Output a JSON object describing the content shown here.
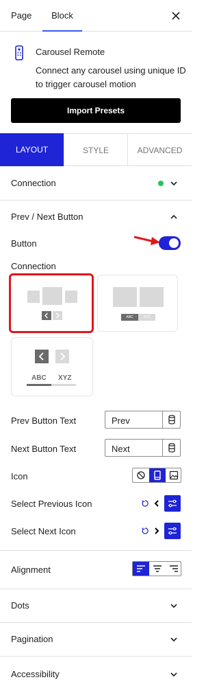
{
  "tabs": {
    "page": "Page",
    "block": "Block"
  },
  "block": {
    "title": "Carousel Remote",
    "description": "Connect any carousel using unique ID to trigger carousel motion",
    "icon": "remote-control-icon"
  },
  "import_button": "Import Presets",
  "section_tabs": {
    "layout": "LAYOUT",
    "style": "STYLE",
    "advanced": "ADVANCED"
  },
  "panels": {
    "connection": "Connection",
    "prev_next": "Prev / Next Button",
    "dots": "Dots",
    "pagination": "Pagination",
    "accessibility": "Accessibility"
  },
  "prev_next": {
    "button_label": "Button",
    "button_on": true,
    "connection_label": "Connection",
    "layout_options": [
      {
        "id": "arrows-under-slides",
        "selected": true
      },
      {
        "id": "abc-xyz-tabs",
        "tab_a": "ABC",
        "tab_b": "XYZ",
        "selected": false
      },
      {
        "id": "arrows-with-labels",
        "tab_a": "ABC",
        "tab_b": "XYZ",
        "selected": false
      }
    ],
    "prev_text_label": "Prev Button Text",
    "prev_text_value": "Prev",
    "next_text_label": "Next Button Text",
    "next_text_value": "Next",
    "icon_label": "Icon",
    "select_prev_label": "Select Previous Icon",
    "select_next_label": "Select Next Icon",
    "alignment_label": "Alignment"
  },
  "colors": {
    "accent": "#1f24d6",
    "selected_border": "#e0171c",
    "status_dot": "#22c55e"
  }
}
